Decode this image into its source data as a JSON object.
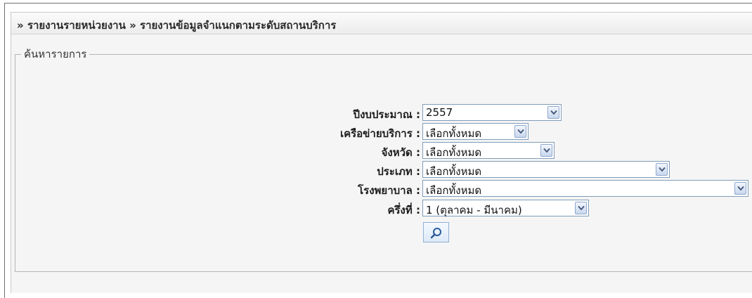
{
  "breadcrumb": {
    "sep": "»",
    "item1": "รายงานรายหน่วยงาน",
    "item2": "รายงานข้อมูลจำแนกตามระดับสถานบริการ"
  },
  "search": {
    "legend": "ค้นหารายการ",
    "fields": [
      {
        "label": "ปีงบประมาณ :",
        "value": "2557"
      },
      {
        "label": "เครือข่ายบริการ :",
        "value": "เลือกทั้งหมด"
      },
      {
        "label": "จังหวัด :",
        "value": "เลือกทั้งหมด"
      },
      {
        "label": "ประเภท :",
        "value": "เลือกทั้งหมด"
      },
      {
        "label": "โรงพยาบาล :",
        "value": "เลือกทั้งหมด"
      },
      {
        "label": "ครึ่งที่ :",
        "value": "1 (ตุลาคม - มีนาคม)"
      }
    ],
    "search_button_icon": "search-icon"
  },
  "colors": {
    "select_border": "#7f9db9",
    "arrow_icon": "#4a5d7e",
    "panel_bg": "#f5f5f5"
  }
}
